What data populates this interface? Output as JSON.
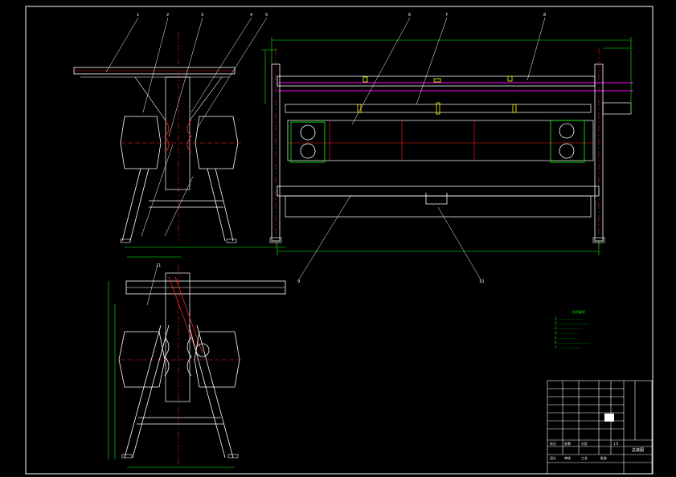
{
  "drawing": {
    "colors": {
      "background": "#000000",
      "frame": "#ffffff",
      "part": "#ffffff",
      "dimension": "#00ff00",
      "detail": "#ff2020",
      "accent": "#ff00ff",
      "yellow": "#ffff00",
      "cyan": "#00ffff"
    },
    "callouts": [
      "1",
      "2",
      "3",
      "4",
      "5",
      "6",
      "7",
      "8",
      "9",
      "10",
      "11"
    ],
    "tech_notes": {
      "heading": "技术要求",
      "lines": [
        "1. ........................",
        "2. ..............................",
        "3. ........................",
        "4. ..................",
        "5. ..................",
        "6. ...............................",
        "7. ......................"
      ]
    },
    "title_block": {
      "name": "总装图",
      "drawing_no": "",
      "labels": [
        "标记",
        "处数",
        "分区",
        "设计",
        "审核",
        "工艺",
        "批准"
      ],
      "scale": "1:5"
    }
  }
}
